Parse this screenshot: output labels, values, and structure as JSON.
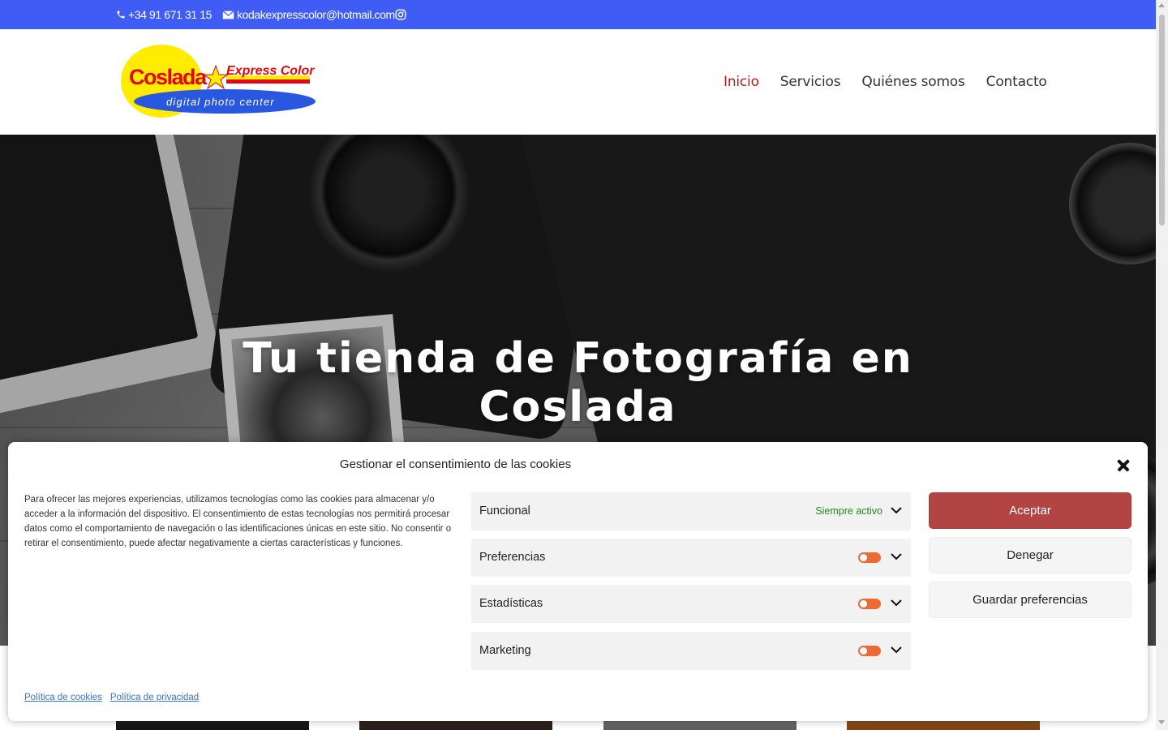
{
  "topbar": {
    "phone": "+34 91 671 31 15",
    "email": "kodakexpresscolor@hotmail.com",
    "icons": [
      "phone-icon",
      "mail-icon",
      "instagram-icon"
    ]
  },
  "brand": {
    "logo_main": "Coslada",
    "logo_sub": "Express Color",
    "logo_tagline": "digital photo center"
  },
  "nav": {
    "items": [
      {
        "label": "Inicio",
        "active": true
      },
      {
        "label": "Servicios",
        "active": false
      },
      {
        "label": "Quiénes somos",
        "active": false
      },
      {
        "label": "Contacto",
        "active": false
      }
    ]
  },
  "hero": {
    "title_line1": "Tu tienda de Fotografía en",
    "title_line2": "Coslada"
  },
  "cookie": {
    "title": "Gestionar el consentimiento de las cookies",
    "description": "Para ofrecer las mejores experiencias, utilizamos tecnologías como las cookies para almacenar y/o acceder a la información del dispositivo. El consentimiento de estas tecnologías nos permitirá procesar datos como el comportamiento de navegación o las identificaciones únicas en este sitio. No consentir o retirar el consentimiento, puede afectar negativamente a ciertas características y funciones.",
    "categories": [
      {
        "label": "Funcional",
        "status": "Siempre activo"
      },
      {
        "label": "Preferencias"
      },
      {
        "label": "Estadísticas"
      },
      {
        "label": "Marketing"
      }
    ],
    "buttons": {
      "accept": "Aceptar",
      "deny": "Denegar",
      "save": "Guardar preferencias"
    },
    "links": {
      "cookies_policy": "Política de cookies",
      "privacy_policy": "Política de privacidad"
    }
  },
  "colors": {
    "topbar": "#3f5cf5",
    "nav_active": "#c0171c",
    "accept": "#b24444",
    "toggle": "#ec6b35",
    "always_active": "#1f8c1f"
  }
}
